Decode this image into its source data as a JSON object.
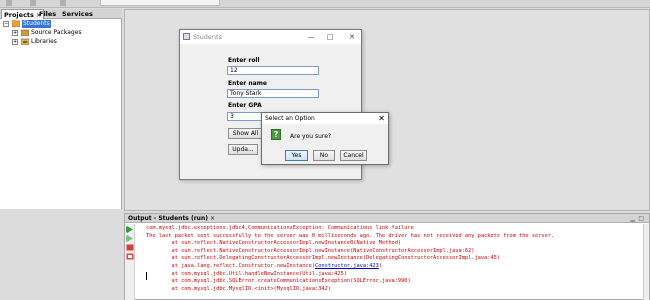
{
  "left_panel": {
    "tabs": [
      {
        "label": "Projects",
        "close": "×"
      },
      {
        "label": "Files"
      },
      {
        "label": "Services"
      }
    ],
    "tree": [
      {
        "label": "Students",
        "expander": "−",
        "selected": true
      },
      {
        "label": "Source Packages",
        "expander": "+"
      },
      {
        "label": "Libraries",
        "expander": "+"
      }
    ]
  },
  "students_window": {
    "title": "Students",
    "controls": {
      "minimize": "—",
      "maximize": "□",
      "close": "✕"
    },
    "roll_label": "Enter roll",
    "roll_value": "12",
    "name_label": "Enter name",
    "name_value": "Tony Stark",
    "gpa_label": "Enter GPA",
    "gpa_value": "3",
    "show_all": "Show All",
    "update": "Upda..."
  },
  "dialog": {
    "title": "Select an Option",
    "close": "✕",
    "icon": "?",
    "message": "Are you sure?",
    "yes": "Yes",
    "no": "No",
    "cancel": "Cancel"
  },
  "output": {
    "title": "Output - Students (run)",
    "close": "×",
    "lines": [
      "com.mysql.jdbc.exceptions.jdbc4.CommunicationsException: Communications link failure",
      "",
      "The last packet sent successfully to the server was 0 milliseconds ago. The driver has not received any packets from the server.",
      "        at sun.reflect.NativeConstructorAccessorImpl.newInstance0(Native Method)",
      "        at sun.reflect.NativeConstructorAccessorImpl.newInstance(NativeConstructorAccessorImpl.java:62)",
      "        at sun.reflect.DelegatingConstructorAccessorImpl.newInstance(DelegatingConstructorAccessorImpl.java:45)",
      "        at java.lang.reflect.Constructor.newInstance(",
      "        at com.mysql.jdbc.Util.handleNewInstance(Util.java:425)",
      "        at com.mysql.jdbc.SQLError.createCommunicationsException(SQLError.java:990)",
      "        at com.mysql.jdbc.MysqlIO.<init>(MysqlIO.java:342)"
    ],
    "link": "Constructor.java:423",
    "link_suffix": ")"
  },
  "colors": {
    "selection": "#3875d7",
    "console_error": "#cc0000",
    "console_link": "#0000cc",
    "question_icon": "#4a9a3e"
  }
}
